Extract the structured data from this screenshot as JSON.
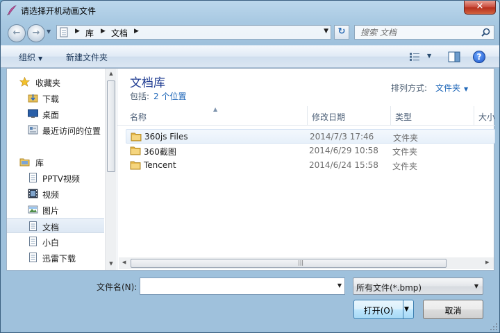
{
  "window": {
    "title": "请选择开机动画文件",
    "close_glyph": "✕"
  },
  "nav_bar": {
    "back_glyph": "←",
    "forward_glyph": "→",
    "breadcrumbs": [
      "库",
      "文档"
    ],
    "search_placeholder": "搜索 文档",
    "refresh_glyph": "↻"
  },
  "toolbar": {
    "organize_label": "组织",
    "new_folder_label": "新建文件夹",
    "help_glyph": "?"
  },
  "sidebar": {
    "items": [
      {
        "label": "收藏夹",
        "icon": "star-icon",
        "level": 0
      },
      {
        "label": "下载",
        "icon": "download-folder-icon",
        "level": 1
      },
      {
        "label": "桌面",
        "icon": "desktop-icon",
        "level": 1
      },
      {
        "label": "最近访问的位置",
        "icon": "recent-places-icon",
        "level": 1
      },
      {
        "label": "库",
        "icon": "library-icon",
        "level": 0
      },
      {
        "label": "PPTV视频",
        "icon": "document-icon",
        "level": 1
      },
      {
        "label": "视频",
        "icon": "video-library-icon",
        "level": 1
      },
      {
        "label": "图片",
        "icon": "picture-library-icon",
        "level": 1
      },
      {
        "label": "文档",
        "icon": "document-icon",
        "level": 1,
        "selected": true
      },
      {
        "label": "小白",
        "icon": "document-icon",
        "level": 1
      },
      {
        "label": "迅雷下载",
        "icon": "document-icon",
        "level": 1
      }
    ]
  },
  "library": {
    "title": "文档库",
    "includes_label": "包括:",
    "includes_link": "2 个位置",
    "sort_label": "排列方式:",
    "sort_value": "文件夹"
  },
  "columns": [
    "名称",
    "修改日期",
    "类型",
    "大小"
  ],
  "files": [
    {
      "name": "360js Files",
      "date": "2014/7/3 17:46",
      "type": "文件夹"
    },
    {
      "name": "360截图",
      "date": "2014/6/29 10:58",
      "type": "文件夹"
    },
    {
      "name": "Tencent",
      "date": "2014/6/24 15:58",
      "type": "文件夹"
    }
  ],
  "bottom": {
    "filename_label": "文件名(N):",
    "filename_value": "",
    "filetype_value": "所有文件(*.bmp)",
    "open_label": "打开(O)",
    "cancel_label": "取消"
  },
  "colors": {
    "selection": "#e7f0fa",
    "link": "#1e66b8",
    "library_title": "#1e3b91"
  }
}
